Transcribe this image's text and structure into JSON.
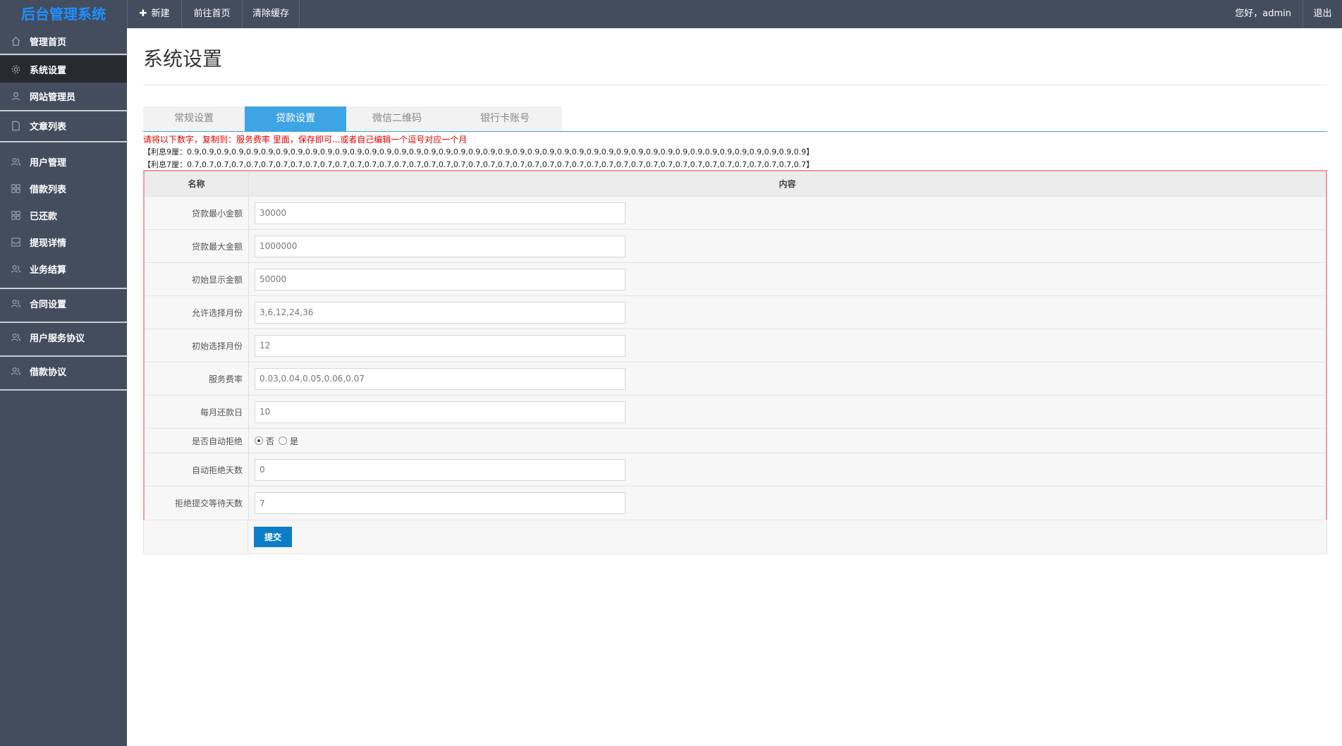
{
  "app": {
    "title": "后台管理系统"
  },
  "topbar": {
    "new_label": "新建",
    "home_label": "前往首页",
    "clear_label": "清除缓存",
    "greeting": "您好，admin",
    "logout": "退出"
  },
  "sidebar": {
    "items": [
      {
        "label": "管理首页",
        "icon": "home-icon"
      },
      {
        "label": "系统设置",
        "icon": "gear-icon",
        "active": true
      },
      {
        "label": "网站管理员",
        "icon": "user-icon"
      },
      {
        "label": "文章列表",
        "icon": "document-icon"
      },
      {
        "label": "用户管理",
        "icon": "users-icon"
      },
      {
        "label": "借款列表",
        "icon": "grid-icon"
      },
      {
        "label": "已还款",
        "icon": "grid-icon"
      },
      {
        "label": "提现详情",
        "icon": "inbox-icon"
      },
      {
        "label": "业务结算",
        "icon": "users-icon"
      },
      {
        "label": "合同设置",
        "icon": "users-icon"
      },
      {
        "label": "用户服务协议",
        "icon": "users-icon"
      },
      {
        "label": "借款协议",
        "icon": "users-icon"
      }
    ]
  },
  "page": {
    "title": "系统设置"
  },
  "tabs": [
    {
      "label": "常规设置"
    },
    {
      "label": "贷款设置",
      "active": true
    },
    {
      "label": "微信二维码"
    },
    {
      "label": "银行卡账号"
    }
  ],
  "notice": {
    "text": "请将以下数字，复制到：服务费率 里面，保存即可...或者自己编辑一个逗号对应一个月",
    "rate9": "【利息9厘：0.9,0.9,0.9,0.9,0.9,0.9,0.9,0.9,0.9,0.9,0.9,0.9,0.9,0.9,0.9,0.9,0.9,0.9,0.9,0.9,0.9,0.9,0.9,0.9,0.9,0.9,0.9,0.9,0.9,0.9,0.9,0.9,0.9,0.9,0.9,0.9,0.9,0.9,0.9,0.9,0.9,0.9】",
    "rate7": "【利息7厘：0.7,0.7,0.7,0.7,0.7,0.7,0.7,0.7,0.7,0.7,0.7,0.7,0.7,0.7,0.7,0.7,0.7,0.7,0.7,0.7,0.7,0.7,0.7,0.7,0.7,0.7,0.7,0.7,0.7,0.7,0.7,0.7,0.7,0.7,0.7,0.7,0.7,0.7,0.7,0.7,0.7,0.7】"
  },
  "table": {
    "header": {
      "name": "名称",
      "content": "内容"
    },
    "fields": [
      {
        "label": "贷款最小金额",
        "value": "30000"
      },
      {
        "label": "贷款最大金额",
        "value": "1000000"
      },
      {
        "label": "初始显示金额",
        "value": "50000"
      },
      {
        "label": "允许选择月份",
        "value": "3,6,12,24,36"
      },
      {
        "label": "初始选择月份",
        "value": "12"
      },
      {
        "label": "服务费率",
        "value": "0.03,0.04,0.05,0.06,0.07"
      },
      {
        "label": "每月还款日",
        "value": "10"
      }
    ],
    "auto_reject": {
      "label": "是否自动拒绝",
      "option_no": "否",
      "option_yes": "是",
      "selected": "否"
    },
    "fields2": [
      {
        "label": "自动拒绝天数",
        "value": "0"
      },
      {
        "label": "拒绝提交等待天数",
        "value": "7"
      }
    ],
    "submit_label": "提交"
  },
  "colors": {
    "topbar": "#434d5e",
    "brand": "#1e90ff",
    "tab_active": "#3fa4e4",
    "button": "#0e7dc8",
    "notice": "#e00000",
    "highlight_border": "#f19aa0"
  }
}
